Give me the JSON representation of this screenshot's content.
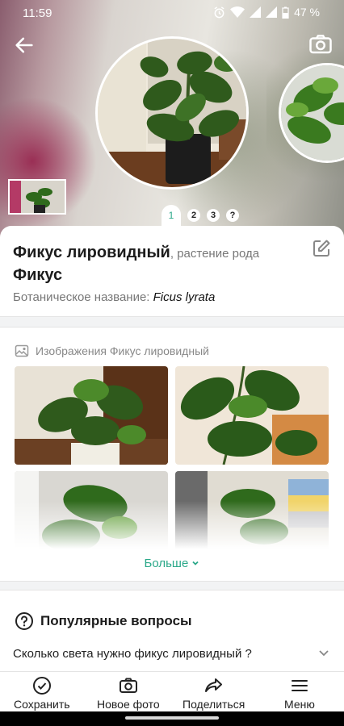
{
  "status_bar": {
    "time": "11:59",
    "battery": "47 %"
  },
  "hero": {
    "pager": {
      "active": "1",
      "pages": [
        "2",
        "3"
      ],
      "help": "?"
    }
  },
  "plant": {
    "name": "Фикус лировидный",
    "genus_prefix": ", растение рода",
    "genus": "Фикус",
    "botanical_label": "Ботаническое название:",
    "botanical_name": "Ficus lyrata"
  },
  "images_section": {
    "title": "Изображения Фикус лировидный",
    "more": "Больше"
  },
  "questions": {
    "title": "Популярные вопросы",
    "items": [
      "Сколько света нужно фикус лировидный ?"
    ]
  },
  "nav": {
    "save": "Сохранить",
    "new_photo": "Новое фото",
    "share": "Поделиться",
    "menu": "Меню"
  },
  "colors": {
    "accent": "#2aa889"
  }
}
